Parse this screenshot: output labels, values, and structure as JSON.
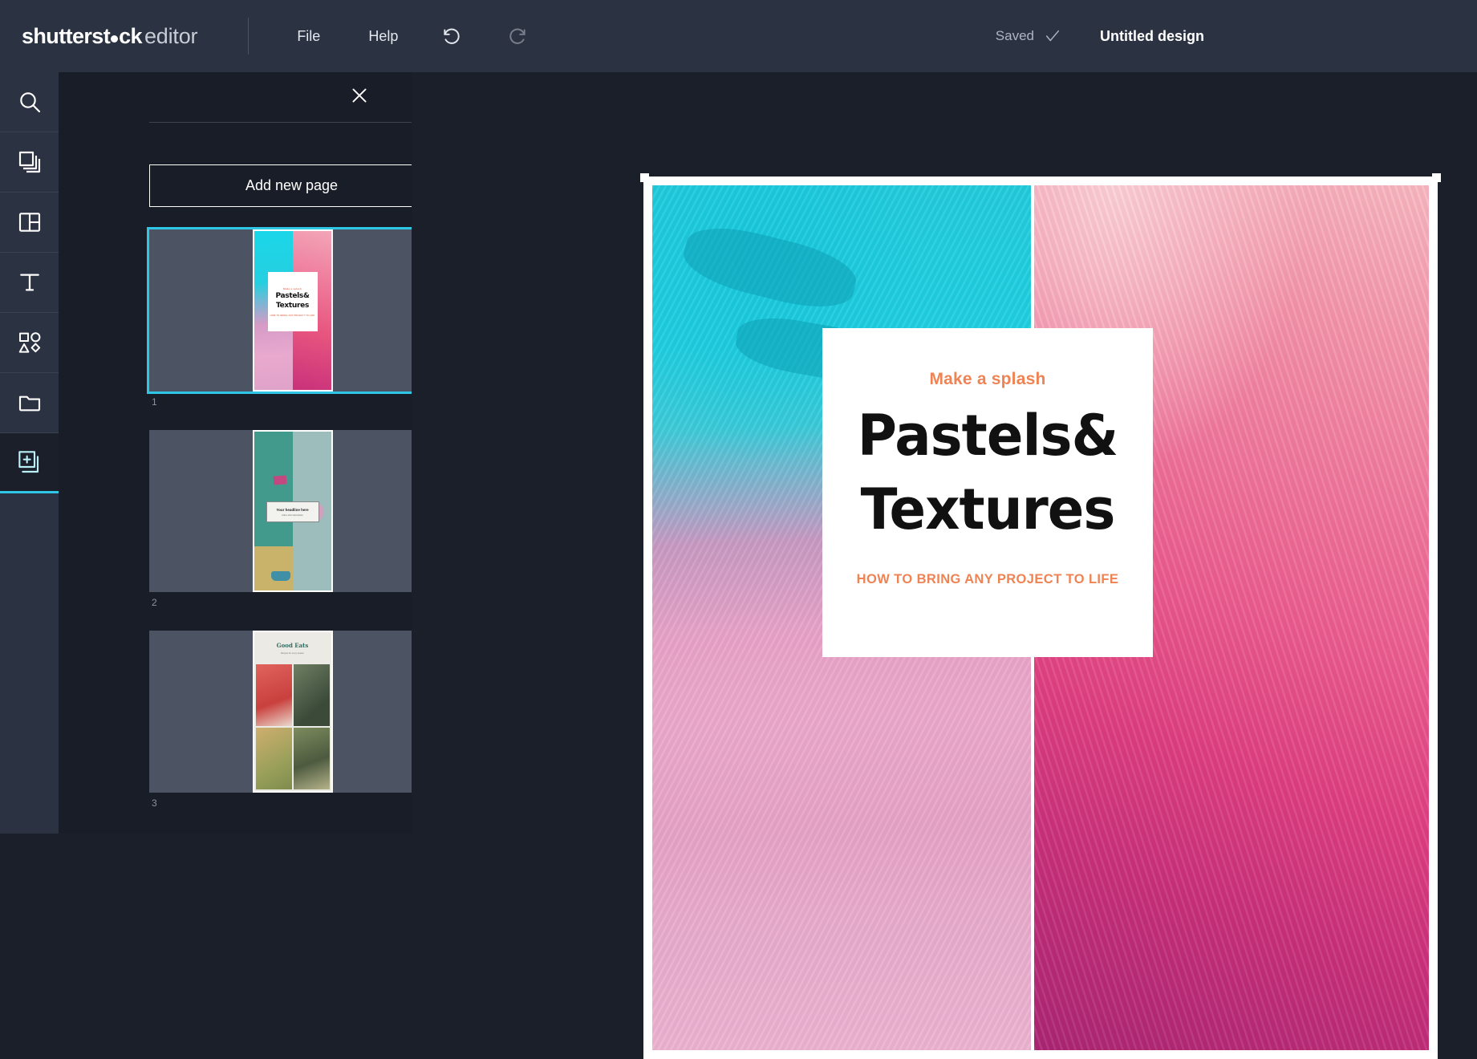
{
  "topbar": {
    "logo_bold": "shutterst",
    "logo_bold_tail": "ck",
    "logo_light": "editor",
    "menu": [
      {
        "label": "File",
        "name": "menu-file"
      },
      {
        "label": "Help",
        "name": "menu-help"
      }
    ],
    "undo_icon": "undo-icon",
    "redo_icon": "redo-icon",
    "saved_label": "Saved",
    "saved_check_icon": "check-icon",
    "document_title": "Untitled design"
  },
  "rail": {
    "items": [
      {
        "name": "sidebar-item-search",
        "icon": "search-icon",
        "active": false
      },
      {
        "name": "sidebar-item-images",
        "icon": "layers-icon",
        "active": false
      },
      {
        "name": "sidebar-item-templates",
        "icon": "template-icon",
        "active": false
      },
      {
        "name": "sidebar-item-text",
        "icon": "text-icon",
        "active": false
      },
      {
        "name": "sidebar-item-shapes",
        "icon": "shapes-icon",
        "active": false
      },
      {
        "name": "sidebar-item-uploads",
        "icon": "folder-icon",
        "active": false
      },
      {
        "name": "sidebar-item-pages",
        "icon": "add-page-icon",
        "active": true
      }
    ]
  },
  "panel": {
    "close_icon": "close-icon",
    "add_page_label": "Add new page",
    "pages": [
      {
        "number": "1",
        "selected": true
      },
      {
        "number": "2",
        "selected": false
      },
      {
        "number": "3",
        "selected": false
      }
    ]
  },
  "thumbnails": {
    "page1": {
      "eyebrow": "Make a splash",
      "title_line1": "Pastels&",
      "title_line2": "Textures",
      "subtitle": "HOW TO BRING ANY PROJECT TO LIFE"
    },
    "page2": {
      "title": "Your headline here",
      "subtitle": "Add a short description"
    },
    "page3": {
      "title": "Good Eats",
      "subtitle": "Recipes for every season"
    }
  },
  "canvas": {
    "eyebrow": "Make a splash",
    "title_line1": "Pastels&",
    "title_line2": "Textures",
    "subtitle": "HOW TO BRING ANY PROJECT TO LIFE"
  },
  "colors": {
    "accent_cyan": "#2ec7e6",
    "accent_orange": "#ef8354",
    "topbar_bg": "#2b3242",
    "panel_bg": "#191d27",
    "canvas_bg": "#1b1f2a"
  }
}
